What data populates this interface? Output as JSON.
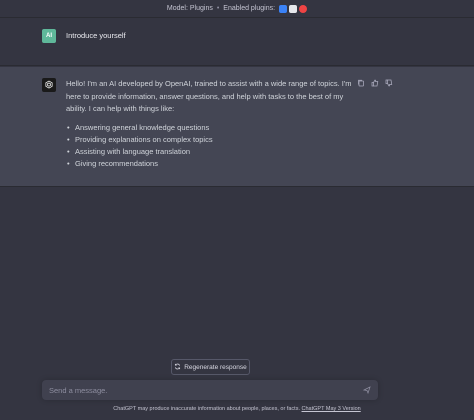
{
  "topbar": {
    "model_label": "Model: Plugins",
    "separator": "•",
    "plugins_label": "Enabled plugins:",
    "plugin_icons": [
      "plugin-blue-icon",
      "plugin-white-icon",
      "plugin-red-icon"
    ]
  },
  "user_message": {
    "avatar": "AI",
    "text": "Introduce yourself"
  },
  "ai_message": {
    "paragraph": "Hello! I'm an AI developed by OpenAI, trained to assist with a wide range of topics. I'm here to provide information, answer questions, and help with tasks to the best of my ability. I can help with things like:",
    "bullets": [
      "Answering general knowledge questions",
      "Providing explanations on complex topics",
      "Assisting with language translation",
      "Giving recommendations"
    ],
    "actions": [
      "copy-icon",
      "thumbs-up-icon",
      "thumbs-down-icon"
    ]
  },
  "regenerate": {
    "label": "Regenerate response",
    "icon": "refresh-icon"
  },
  "composer": {
    "placeholder": "Send a message.",
    "send_icon": "send-icon"
  },
  "footer": {
    "text": "ChatGPT may produce inaccurate information about people, places, or facts.",
    "link": "ChatGPT May 3 Version"
  },
  "colors": {
    "background": "#343541",
    "ai_row": "#444654",
    "user_avatar": "#5fb89a",
    "input": "#40414f"
  }
}
